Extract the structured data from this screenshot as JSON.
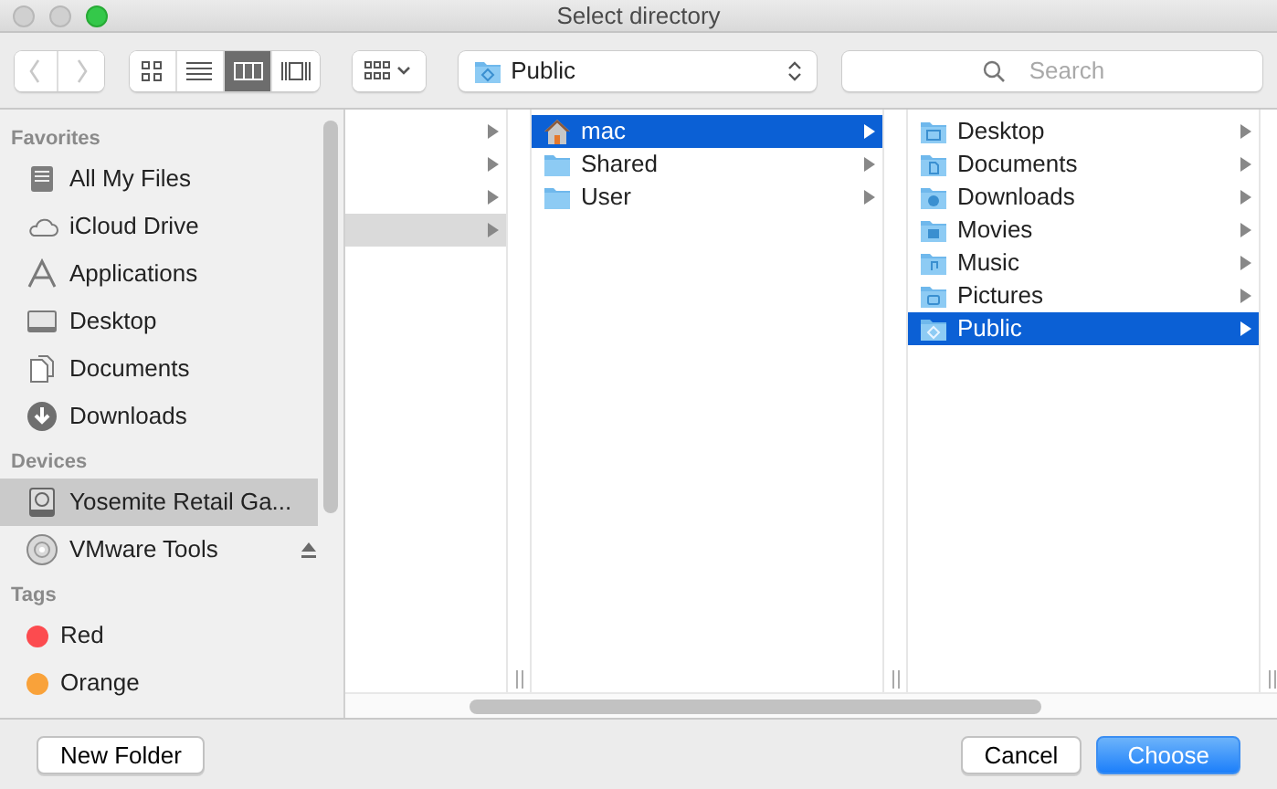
{
  "window": {
    "title": "Select directory"
  },
  "toolbar": {
    "back_enabled": false,
    "forward_enabled": false,
    "views": [
      {
        "kind": "icons",
        "selected": false
      },
      {
        "kind": "list",
        "selected": false
      },
      {
        "kind": "columns",
        "selected": true
      },
      {
        "kind": "coverflow",
        "selected": false
      }
    ],
    "path": {
      "kind": "public",
      "label": "Public"
    },
    "search": {
      "placeholder": "Search"
    }
  },
  "sidebar": {
    "sections": [
      {
        "heading": "Favorites",
        "items": [
          {
            "kind": "files",
            "label": "All My Files",
            "selected": false
          },
          {
            "kind": "cloud",
            "label": "iCloud Drive",
            "selected": false
          },
          {
            "kind": "apps",
            "label": "Applications",
            "selected": false
          },
          {
            "kind": "desktop",
            "label": "Desktop",
            "selected": false
          },
          {
            "kind": "documents",
            "label": "Documents",
            "selected": false
          },
          {
            "kind": "downloads",
            "label": "Downloads",
            "selected": false
          }
        ]
      },
      {
        "heading": "Devices",
        "items": [
          {
            "kind": "disk",
            "label": "Yosemite Retail Ga...",
            "selected": true
          },
          {
            "kind": "cd",
            "label": "VMware Tools",
            "selected": false,
            "eject": true
          }
        ]
      },
      {
        "heading": "Tags",
        "items": [
          {
            "kind": "tag",
            "label": "Red",
            "selected": false,
            "color": "#fc4b4f"
          },
          {
            "kind": "tag",
            "label": "Orange",
            "selected": false,
            "color": "#f9a23a"
          }
        ]
      }
    ]
  },
  "columns": [
    {
      "focused": false,
      "items": [
        {
          "selected": false
        },
        {
          "selected": false
        },
        {
          "selected": false
        },
        {
          "selected": true
        }
      ]
    },
    {
      "focused": true,
      "items": [
        {
          "kind": "home",
          "label": "mac",
          "selected": true
        },
        {
          "kind": "folder",
          "label": "Shared",
          "selected": false
        },
        {
          "kind": "folder",
          "label": "User",
          "selected": false
        }
      ]
    },
    {
      "focused": true,
      "items": [
        {
          "kind": "desktop",
          "label": "Desktop",
          "selected": false
        },
        {
          "kind": "documents",
          "label": "Documents",
          "selected": false
        },
        {
          "kind": "downloads",
          "label": "Downloads",
          "selected": false
        },
        {
          "kind": "movies",
          "label": "Movies",
          "selected": false
        },
        {
          "kind": "music",
          "label": "Music",
          "selected": false
        },
        {
          "kind": "pictures",
          "label": "Pictures",
          "selected": false
        },
        {
          "kind": "public",
          "label": "Public",
          "selected": true
        }
      ]
    }
  ],
  "buttons": [
    {
      "label": "New Folder",
      "kind": "normal"
    },
    {
      "label": "Cancel",
      "kind": "normal"
    },
    {
      "label": "Choose",
      "kind": "default"
    }
  ]
}
